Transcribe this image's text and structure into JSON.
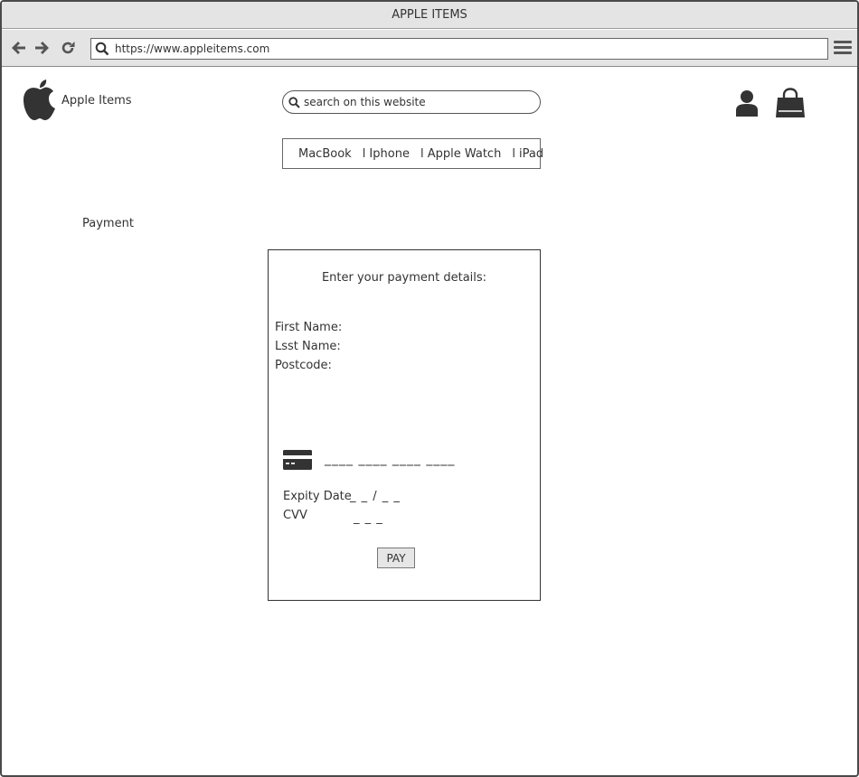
{
  "window": {
    "title": "APPLE ITEMS"
  },
  "browser": {
    "url": "https://www.appleitems.com",
    "icons": {
      "back": "arrow-left-icon",
      "forward": "arrow-right-icon",
      "reload": "reload-icon",
      "url_search": "search-icon",
      "menu": "hamburger-menu-icon"
    }
  },
  "header": {
    "brand": "Apple Items",
    "logo_icon": "apple-logo-icon",
    "search_placeholder": "search on this website",
    "user_icon": "user-icon",
    "cart_icon": "shopping-bag-icon"
  },
  "nav": {
    "items": [
      {
        "label": "MacBook"
      },
      {
        "label": "l Iphone"
      },
      {
        "label": "l Apple Watch"
      },
      {
        "label": "l iPad"
      }
    ]
  },
  "page": {
    "section_title": "Payment"
  },
  "payment": {
    "heading": "Enter your payment details:",
    "first_name_label": "First Name:",
    "last_name_label": "Lsst Name:",
    "postcode_label": "Postcode:",
    "card_icon": "credit-card-icon",
    "card_number": "____ ____ ____ ____",
    "expiry_label": "Expity Date",
    "expiry_value": "_ _ / _ _",
    "cvv_label": "CVV",
    "cvv_value": "_ _ _",
    "pay_label": "PAY"
  }
}
